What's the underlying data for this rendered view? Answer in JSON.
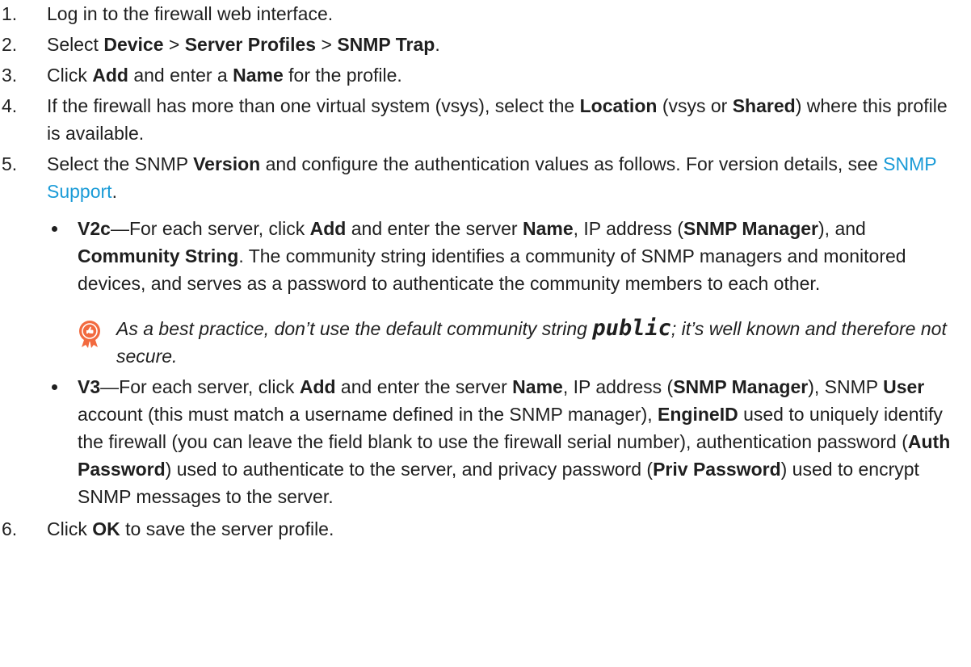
{
  "steps": [
    {
      "num": "1.",
      "parts": [
        {
          "t": "Log in to the firewall web interface."
        }
      ]
    },
    {
      "num": "2.",
      "parts": [
        {
          "t": "Select "
        },
        {
          "t": "Device",
          "b": true
        },
        {
          "t": " > "
        },
        {
          "t": "Server Profiles",
          "b": true
        },
        {
          "t": " > "
        },
        {
          "t": "SNMP Trap",
          "b": true
        },
        {
          "t": "."
        }
      ]
    },
    {
      "num": "3.",
      "parts": [
        {
          "t": "Click "
        },
        {
          "t": "Add",
          "b": true
        },
        {
          "t": " and enter a "
        },
        {
          "t": "Name",
          "b": true
        },
        {
          "t": " for the profile."
        }
      ]
    },
    {
      "num": "4.",
      "parts": [
        {
          "t": "If the firewall has more than one virtual system (vsys), select the "
        },
        {
          "t": "Location",
          "b": true
        },
        {
          "t": " (vsys or "
        },
        {
          "t": "Shared",
          "b": true
        },
        {
          "t": ") where this profile is available."
        }
      ]
    },
    {
      "num": "5.",
      "parts": [
        {
          "t": "Select the SNMP "
        },
        {
          "t": "Version",
          "b": true
        },
        {
          "t": " and configure the authentication values as follows. For version details, see "
        },
        {
          "t": "SNMP Support",
          "link": true
        },
        {
          "t": "."
        }
      ]
    },
    {
      "num": "6.",
      "parts": [
        {
          "t": "Click "
        },
        {
          "t": "OK",
          "b": true
        },
        {
          "t": " to save the server profile."
        }
      ]
    }
  ],
  "bullets": [
    {
      "parts": [
        {
          "t": "V2c",
          "b": true
        },
        {
          "t": "—For each server, click "
        },
        {
          "t": "Add",
          "b": true
        },
        {
          "t": " and enter the server "
        },
        {
          "t": "Name",
          "b": true
        },
        {
          "t": ", IP address ("
        },
        {
          "t": "SNMP Manager",
          "b": true
        },
        {
          "t": "), and "
        },
        {
          "t": "Community String",
          "b": true
        },
        {
          "t": ". The community string identifies a community of SNMP managers and monitored devices, and serves as a password to authenticate the community members to each other."
        }
      ]
    },
    {
      "parts": [
        {
          "t": "V3",
          "b": true
        },
        {
          "t": "—For each server, click "
        },
        {
          "t": "Add",
          "b": true
        },
        {
          "t": " and enter the server "
        },
        {
          "t": "Name",
          "b": true
        },
        {
          "t": ", IP address ("
        },
        {
          "t": "SNMP Manager",
          "b": true
        },
        {
          "t": "), SNMP "
        },
        {
          "t": "User",
          "b": true
        },
        {
          "t": " account (this must match a username defined in the SNMP manager), "
        },
        {
          "t": "EngineID",
          "b": true
        },
        {
          "t": " used to uniquely identify the firewall (you can leave the field blank to use the firewall serial number), authentication password ("
        },
        {
          "t": "Auth Password",
          "b": true
        },
        {
          "t": ") used to authenticate to the server, and privacy password ("
        },
        {
          "t": "Priv Password",
          "b": true
        },
        {
          "t": ") used to encrypt SNMP messages to the server."
        }
      ]
    }
  ],
  "note": {
    "icon": "best-practice-ribbon-icon",
    "parts": [
      {
        "t": "As a best practice, don’t use the default community string "
      },
      {
        "t": "public",
        "mono": true
      },
      {
        "t": "; it’s well known and therefore not secure."
      }
    ]
  },
  "colors": {
    "link": "#1a9bd7",
    "icon": "#f26a3f",
    "text": "#1f1f1f"
  }
}
